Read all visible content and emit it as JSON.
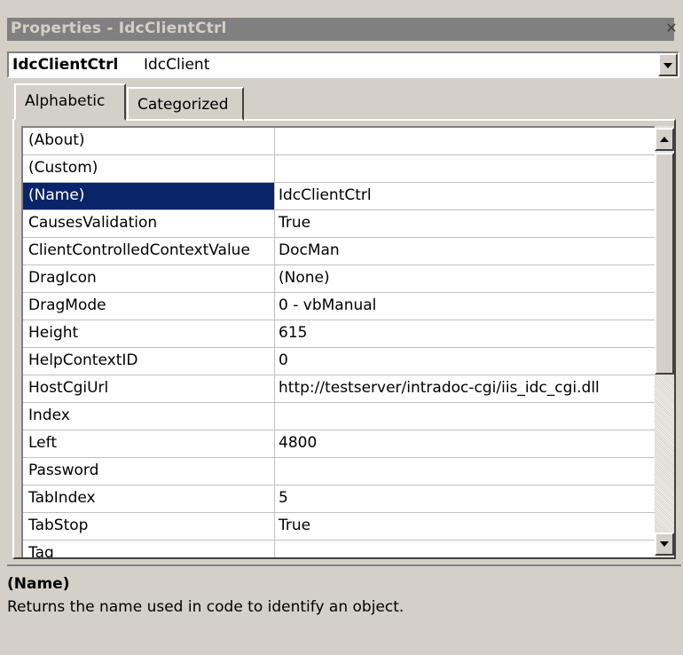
{
  "window": {
    "title": "Properties - IdcClientCtrl",
    "close_glyph": "✕"
  },
  "object_selector": {
    "name": "IdcClientCtrl",
    "class": "IdcClient"
  },
  "tabs": [
    {
      "label": "Alphabetic",
      "active": true
    },
    {
      "label": "Categorized",
      "active": false
    }
  ],
  "properties": [
    {
      "name": "(About)",
      "value": ""
    },
    {
      "name": "(Custom)",
      "value": ""
    },
    {
      "name": "(Name)",
      "value": "IdcClientCtrl",
      "selected": true
    },
    {
      "name": "CausesValidation",
      "value": "True"
    },
    {
      "name": "ClientControlledContextValue",
      "value": "DocMan"
    },
    {
      "name": "DragIcon",
      "value": "(None)"
    },
    {
      "name": "DragMode",
      "value": "0 - vbManual"
    },
    {
      "name": "Height",
      "value": "615"
    },
    {
      "name": "HelpContextID",
      "value": "0"
    },
    {
      "name": "HostCgiUrl",
      "value": "http://testserver/intradoc-cgi/iis_idc_cgi.dll"
    },
    {
      "name": "Index",
      "value": ""
    },
    {
      "name": "Left",
      "value": "4800"
    },
    {
      "name": "Password",
      "value": ""
    },
    {
      "name": "TabIndex",
      "value": "5"
    },
    {
      "name": "TabStop",
      "value": "True"
    },
    {
      "name": "Tag",
      "value": ""
    }
  ],
  "description": {
    "title": "(Name)",
    "text": "Returns the name used in code to identify an object."
  },
  "colors": {
    "selection": "#0a246a",
    "face": "#d4d0c8",
    "titlebar_inactive": "#808080"
  }
}
